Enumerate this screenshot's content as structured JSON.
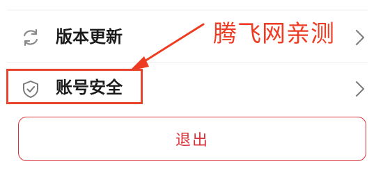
{
  "settings": {
    "items": [
      {
        "label": "版本更新",
        "icon": "refresh-icon"
      },
      {
        "label": "账号安全",
        "icon": "shield-check-icon"
      }
    ]
  },
  "logout": {
    "label": "退出"
  },
  "annotation": {
    "watermark": "腾飞网亲测",
    "color": "#ee3c22"
  },
  "colors": {
    "accent": "#d9323a",
    "divider": "#ececec"
  }
}
